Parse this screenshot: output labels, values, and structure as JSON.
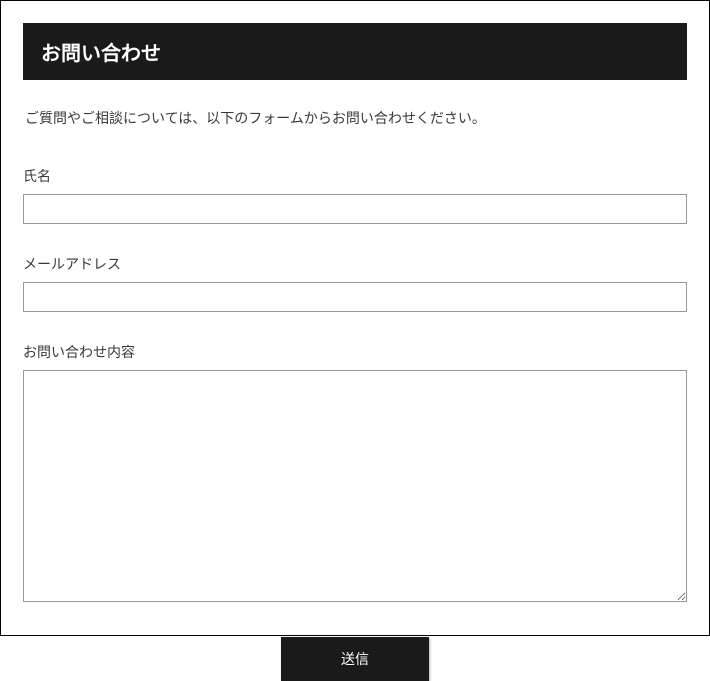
{
  "header": {
    "title": "お問い合わせ"
  },
  "description": "ご質問やご相談については、以下のフォームからお問い合わせください。",
  "form": {
    "name": {
      "label": "氏名",
      "value": ""
    },
    "email": {
      "label": "メールアドレス",
      "value": ""
    },
    "message": {
      "label": "お問い合わせ内容",
      "value": ""
    },
    "submit_label": "送信"
  }
}
